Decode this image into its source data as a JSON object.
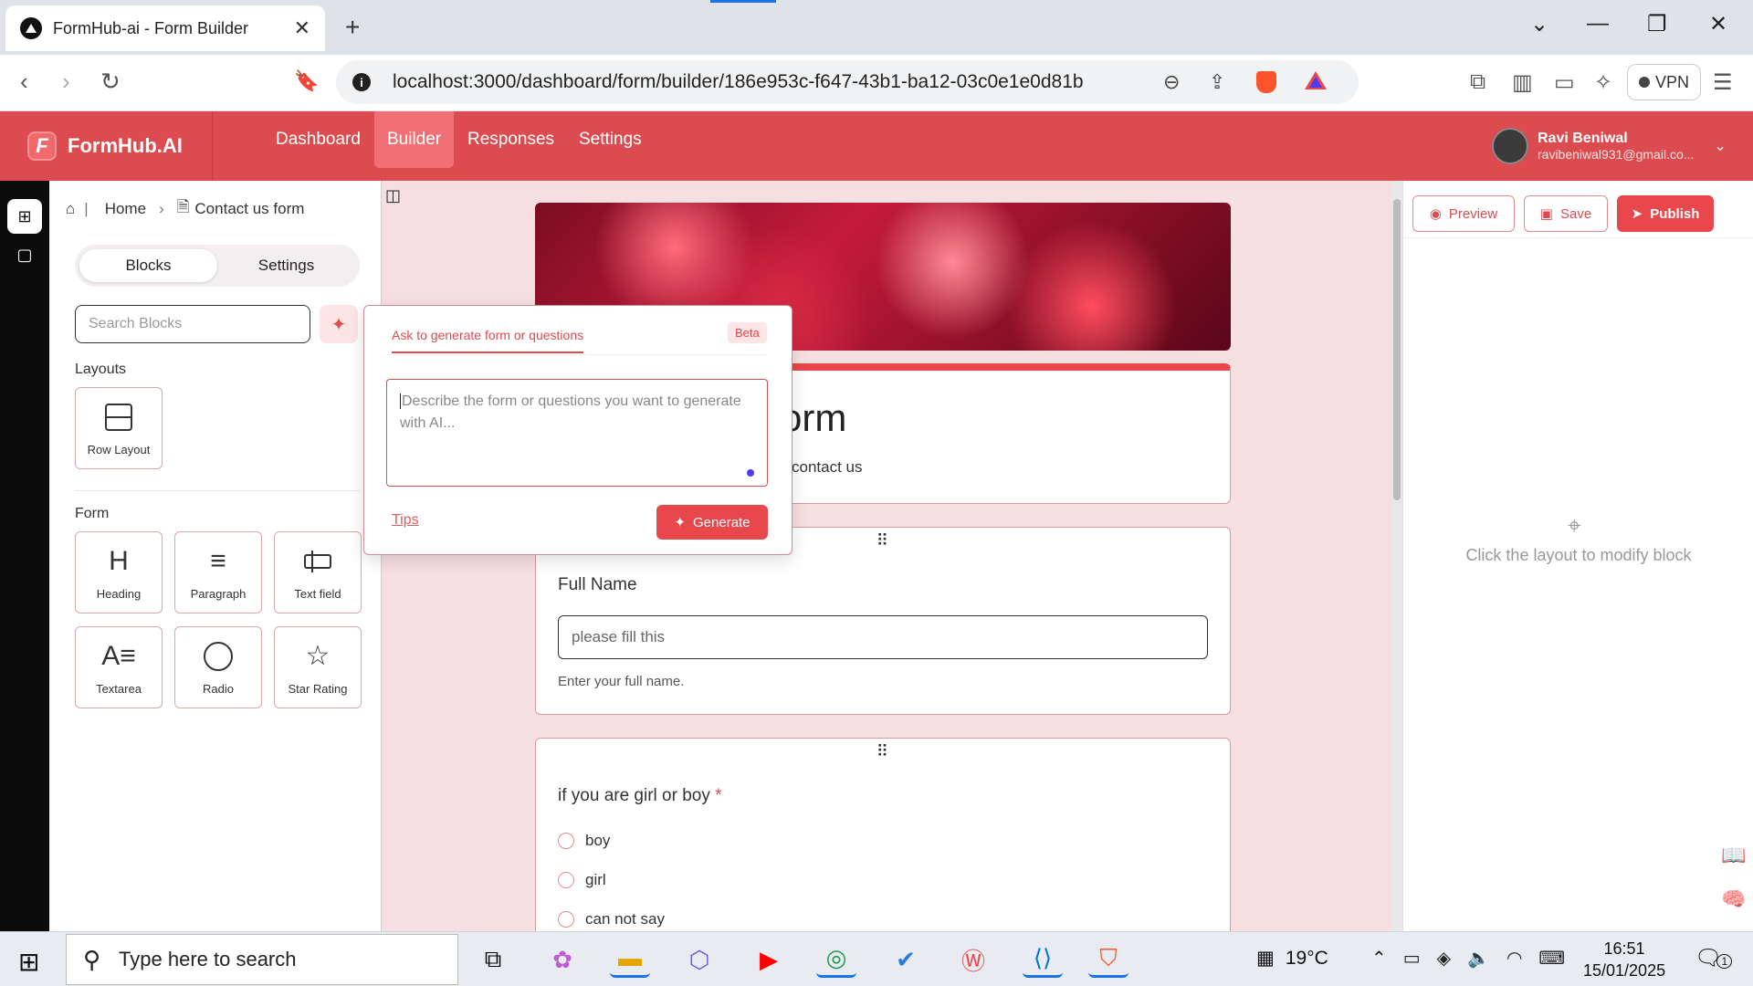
{
  "browser": {
    "tab_title": "FormHub-ai - Form Builder",
    "tab_close": "✕",
    "new_tab": "+",
    "url": "localhost:3000/dashboard/form/builder/186e953c-f647-43b1-ba12-03c0e1e0d81b",
    "vpn_label": "VPN"
  },
  "app": {
    "logo_letter": "F",
    "logo_text": "FormHub.AI",
    "nav": [
      "Dashboard",
      "Builder",
      "Responses",
      "Settings"
    ],
    "active_nav": "Builder",
    "user_name": "Ravi Beniwal",
    "user_email": "ravibeniwal931@gmail.co..."
  },
  "left_panel": {
    "breadcrumb_home": "Home",
    "breadcrumb_current": "Contact us form",
    "tabs": [
      "Blocks",
      "Settings"
    ],
    "search_placeholder": "Search Blocks",
    "layouts_label": "Layouts",
    "layouts": [
      {
        "label": "Row Layout",
        "icon": "row-layout-icon"
      }
    ],
    "form_label": "Form",
    "form_blocks": [
      {
        "label": "Heading",
        "icon": "heading-icon"
      },
      {
        "label": "Paragraph",
        "icon": "paragraph-icon"
      },
      {
        "label": "Text field",
        "icon": "text-field-icon"
      },
      {
        "label": "Textarea",
        "icon": "textarea-icon"
      },
      {
        "label": "Radio",
        "icon": "radio-icon"
      },
      {
        "label": "Star Rating",
        "icon": "star-icon"
      }
    ]
  },
  "canvas": {
    "title_visible": "orm",
    "subtitle_visible": "contact us",
    "fields": [
      {
        "label": "Full Name",
        "placeholder": "please fill this",
        "help": "Enter your full name."
      },
      {
        "label": "if you are girl or boy",
        "required_mark": "*",
        "options": [
          "boy",
          "girl",
          "can not say"
        ]
      }
    ]
  },
  "ai_popup": {
    "tab_label": "Ask to generate form or questions",
    "badge": "Beta",
    "placeholder": "Describe the form or questions    you want to generate with AI...",
    "tips_label": "Tips",
    "generate_label": "Generate"
  },
  "right_panel": {
    "preview_label": "Preview",
    "save_label": "Save",
    "publish_label": "Publish",
    "hint": "Click the layout to modify block"
  },
  "taskbar": {
    "search_placeholder": "Type here to search",
    "temperature": "19°C",
    "time": "16:51",
    "date": "15/01/2025",
    "notification_count": "1"
  },
  "colors": {
    "brand": "#dc4b4f",
    "canvas_bg": "#f6dfe1"
  }
}
